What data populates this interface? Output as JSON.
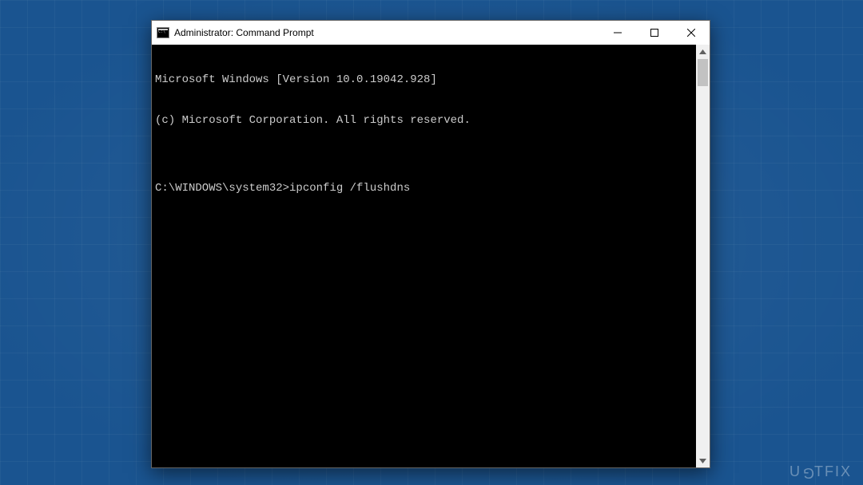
{
  "window": {
    "title": "Administrator: Command Prompt"
  },
  "terminal": {
    "line1": "Microsoft Windows [Version 10.0.19042.928]",
    "line2": "(c) Microsoft Corporation. All rights reserved.",
    "blank": "",
    "prompt": "C:\\WINDOWS\\system32>",
    "command": "ipconfig /flushdns"
  },
  "watermark": {
    "pre": "U",
    "rot": "G",
    "mid": "",
    "post": "TFIX"
  }
}
